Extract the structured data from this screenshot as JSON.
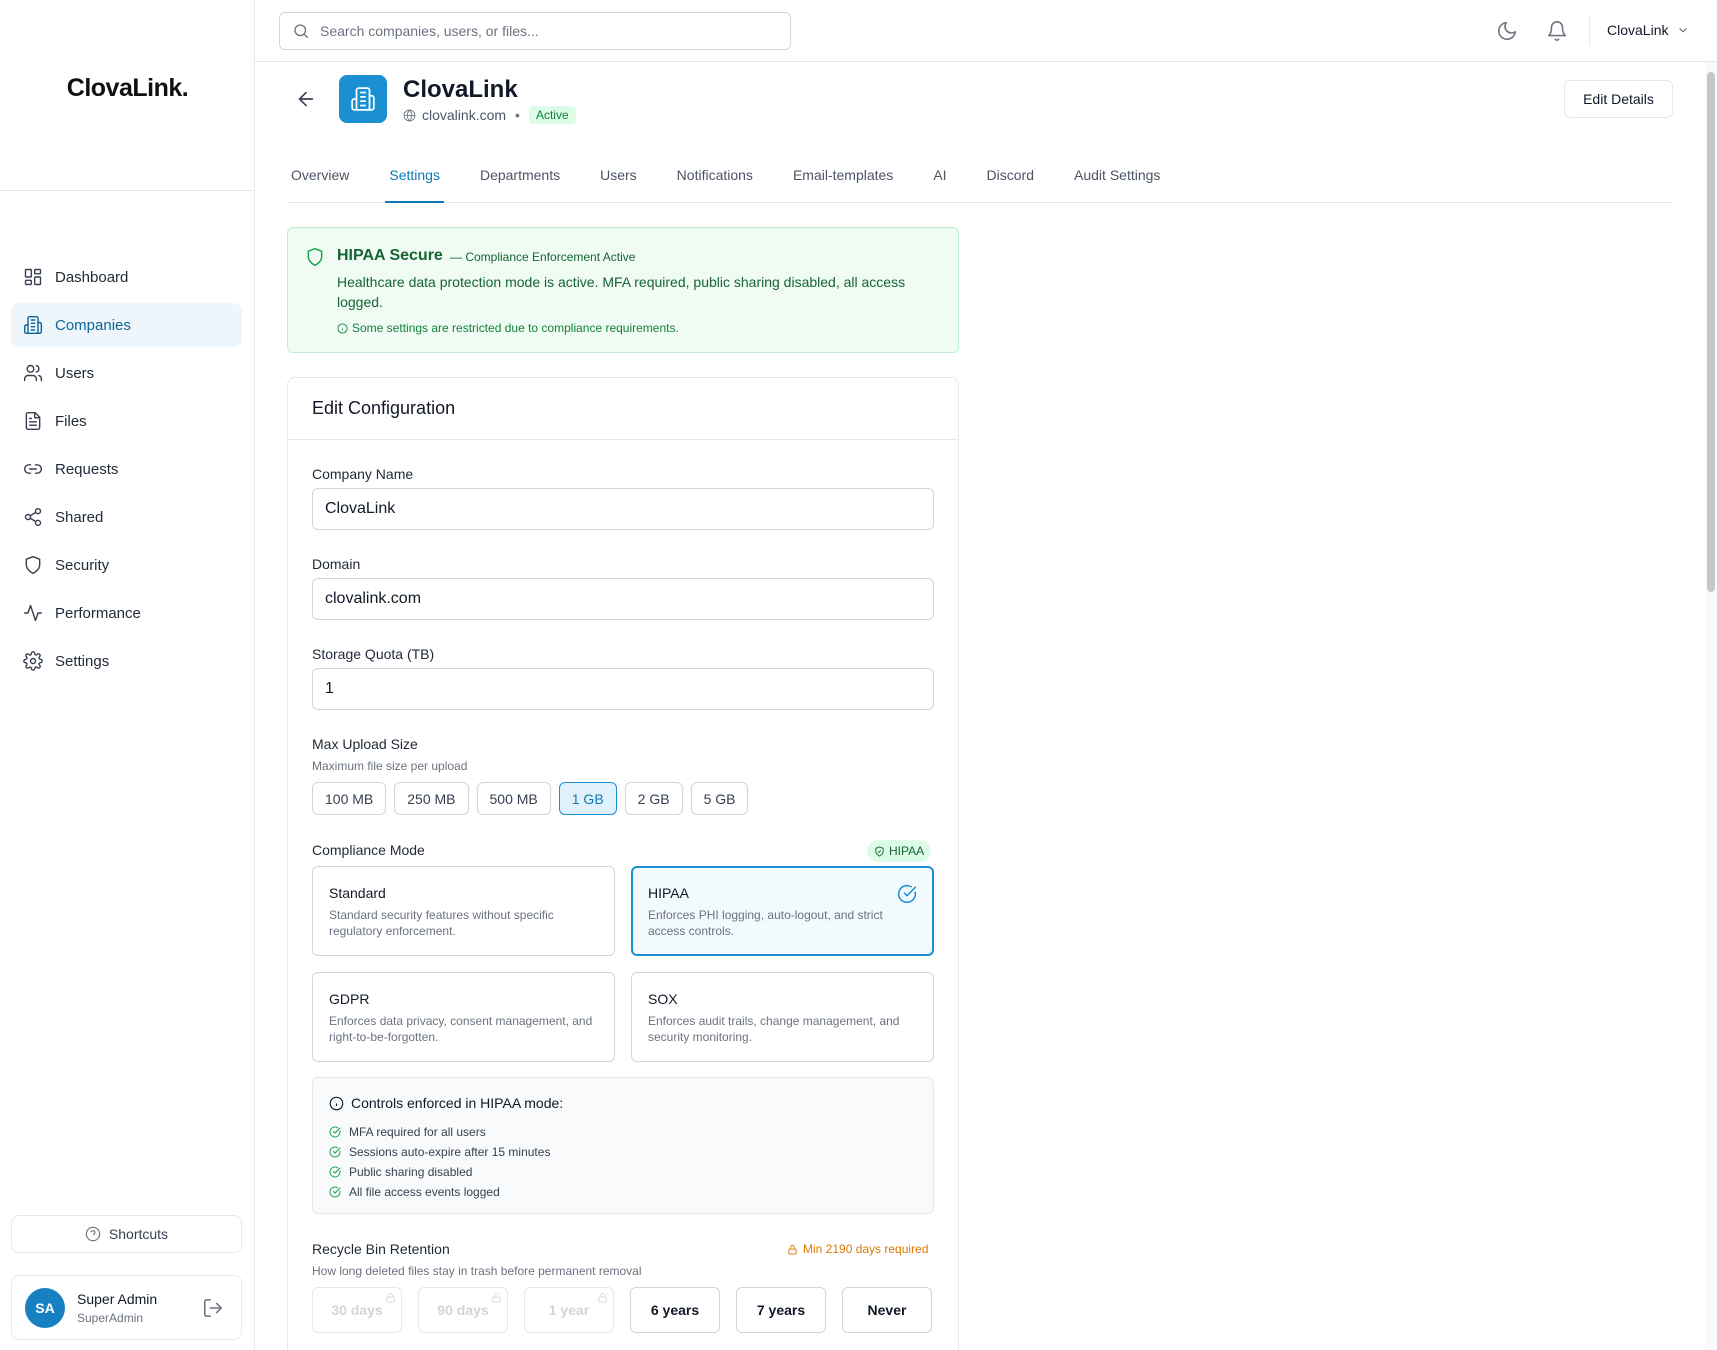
{
  "app": {
    "logo": "ClovaLink."
  },
  "sidebar": {
    "items": [
      {
        "label": "Dashboard",
        "icon": "dashboard-icon"
      },
      {
        "label": "Companies",
        "icon": "building-icon",
        "active": true
      },
      {
        "label": "Users",
        "icon": "users-icon"
      },
      {
        "label": "Files",
        "icon": "file-icon"
      },
      {
        "label": "Requests",
        "icon": "link-icon"
      },
      {
        "label": "Shared",
        "icon": "share-icon"
      },
      {
        "label": "Security",
        "icon": "shield-icon"
      },
      {
        "label": "Performance",
        "icon": "activity-icon"
      },
      {
        "label": "Settings",
        "icon": "gear-icon"
      }
    ],
    "shortcuts_label": "Shortcuts",
    "user": {
      "initials": "SA",
      "name": "Super Admin",
      "role": "SuperAdmin"
    }
  },
  "topbar": {
    "search_placeholder": "Search companies, users, or files...",
    "company_switcher": "ClovaLink"
  },
  "header": {
    "company_name": "ClovaLink",
    "domain": "clovalink.com",
    "status": "Active",
    "edit_button": "Edit Details"
  },
  "tabs": [
    {
      "label": "Overview"
    },
    {
      "label": "Settings",
      "active": true
    },
    {
      "label": "Departments"
    },
    {
      "label": "Users"
    },
    {
      "label": "Notifications"
    },
    {
      "label": "Email-templates"
    },
    {
      "label": "AI"
    },
    {
      "label": "Discord"
    },
    {
      "label": "Audit Settings"
    }
  ],
  "banner": {
    "title": "HIPAA Secure",
    "subtitle": "— Compliance Enforcement Active",
    "body": "Healthcare data protection mode is active. MFA required, public sharing disabled, all access logged.",
    "note": "Some settings are restricted due to compliance requirements."
  },
  "config": {
    "title": "Edit Configuration",
    "company_name_label": "Company Name",
    "company_name_value": "ClovaLink",
    "domain_label": "Domain",
    "domain_value": "clovalink.com",
    "quota_label": "Storage Quota (TB)",
    "quota_value": "1",
    "upload_label": "Max Upload Size",
    "upload_hint": "Maximum file size per upload",
    "upload_options": [
      "100 MB",
      "250 MB",
      "500 MB",
      "1 GB",
      "2 GB",
      "5 GB"
    ],
    "upload_selected": "1 GB",
    "compliance_label": "Compliance Mode",
    "compliance_tag": "HIPAA",
    "modes": [
      {
        "title": "Standard",
        "desc": "Standard security features without specific regulatory enforcement."
      },
      {
        "title": "HIPAA",
        "desc": "Enforces PHI logging, auto-logout, and strict access controls.",
        "selected": true
      },
      {
        "title": "GDPR",
        "desc": "Enforces data privacy, consent management, and right-to-be-forgotten."
      },
      {
        "title": "SOX",
        "desc": "Enforces audit trails, change management, and security monitoring."
      }
    ],
    "controls_title": "Controls enforced in HIPAA mode:",
    "controls": [
      "MFA required for all users",
      "Sessions auto-expire after 15 minutes",
      "Public sharing disabled",
      "All file access events logged"
    ],
    "retention_label": "Recycle Bin Retention",
    "retention_hint": "How long deleted files stay in trash before permanent removal",
    "retention_min": "Min 2190 days required",
    "retention_options": [
      {
        "label": "30 days",
        "disabled": true
      },
      {
        "label": "90 days",
        "disabled": true
      },
      {
        "label": "1 year",
        "disabled": true
      },
      {
        "label": "6 years",
        "disabled": false
      },
      {
        "label": "7 years",
        "disabled": false
      },
      {
        "label": "Never",
        "disabled": false
      }
    ]
  },
  "colors": {
    "accent": "#1a8fd1",
    "success": "#16a34a",
    "warning": "#d97706"
  }
}
